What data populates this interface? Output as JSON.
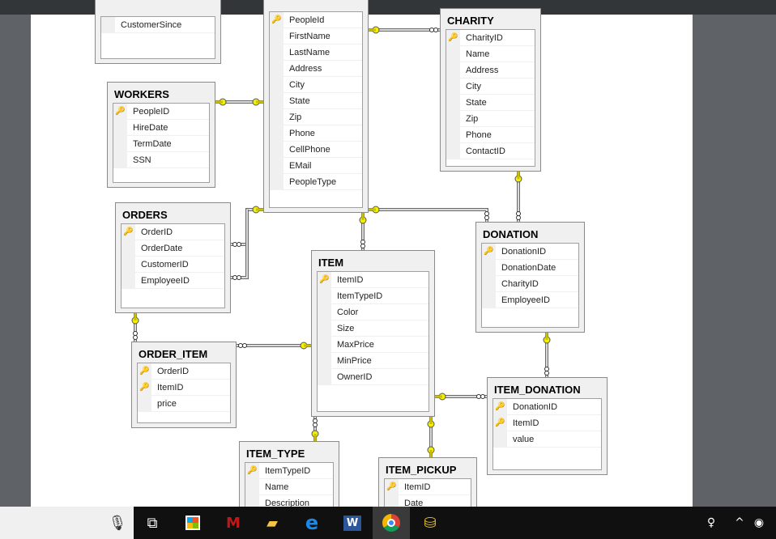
{
  "tables": [
    {
      "id": "customer",
      "title": "",
      "rows": [
        {
          "name": "CustomerSince",
          "pk": false
        }
      ]
    },
    {
      "id": "people",
      "title": "",
      "rows": [
        {
          "name": "PeopleId",
          "pk": true
        },
        {
          "name": "FirstName",
          "pk": false
        },
        {
          "name": "LastName",
          "pk": false
        },
        {
          "name": "Address",
          "pk": false
        },
        {
          "name": "City",
          "pk": false
        },
        {
          "name": "State",
          "pk": false
        },
        {
          "name": "Zip",
          "pk": false
        },
        {
          "name": "Phone",
          "pk": false
        },
        {
          "name": "CellPhone",
          "pk": false
        },
        {
          "name": "EMail",
          "pk": false
        },
        {
          "name": "PeopleType",
          "pk": false
        }
      ]
    },
    {
      "id": "charity",
      "title": "CHARITY",
      "rows": [
        {
          "name": "CharityID",
          "pk": true
        },
        {
          "name": "Name",
          "pk": false
        },
        {
          "name": "Address",
          "pk": false
        },
        {
          "name": "City",
          "pk": false
        },
        {
          "name": "State",
          "pk": false
        },
        {
          "name": "Zip",
          "pk": false
        },
        {
          "name": "Phone",
          "pk": false
        },
        {
          "name": "ContactID",
          "pk": false
        }
      ]
    },
    {
      "id": "workers",
      "title": "WORKERS",
      "rows": [
        {
          "name": "PeopleID",
          "pk": true
        },
        {
          "name": "HireDate",
          "pk": false
        },
        {
          "name": "TermDate",
          "pk": false
        },
        {
          "name": "SSN",
          "pk": false
        }
      ]
    },
    {
      "id": "orders",
      "title": "ORDERS",
      "rows": [
        {
          "name": "OrderID",
          "pk": true
        },
        {
          "name": "OrderDate",
          "pk": false
        },
        {
          "name": "CustomerID",
          "pk": false
        },
        {
          "name": "EmployeeID",
          "pk": false
        }
      ]
    },
    {
      "id": "item",
      "title": "ITEM",
      "rows": [
        {
          "name": "ItemID",
          "pk": true
        },
        {
          "name": "ItemTypeID",
          "pk": false
        },
        {
          "name": "Color",
          "pk": false
        },
        {
          "name": "Size",
          "pk": false
        },
        {
          "name": "MaxPrice",
          "pk": false
        },
        {
          "name": "MinPrice",
          "pk": false
        },
        {
          "name": "OwnerID",
          "pk": false
        }
      ]
    },
    {
      "id": "donation",
      "title": "DONATION",
      "rows": [
        {
          "name": "DonationID",
          "pk": true
        },
        {
          "name": "DonationDate",
          "pk": false
        },
        {
          "name": "CharityID",
          "pk": false
        },
        {
          "name": "EmployeeID",
          "pk": false
        }
      ]
    },
    {
      "id": "order_item",
      "title": "ORDER_ITEM",
      "rows": [
        {
          "name": "OrderID",
          "pk": true
        },
        {
          "name": "ItemID",
          "pk": true
        },
        {
          "name": "price",
          "pk": false
        }
      ]
    },
    {
      "id": "item_donation",
      "title": "ITEM_DONATION",
      "rows": [
        {
          "name": "DonationID",
          "pk": true
        },
        {
          "name": "ItemID",
          "pk": true
        },
        {
          "name": "value",
          "pk": false
        }
      ]
    },
    {
      "id": "item_type",
      "title": "ITEM_TYPE",
      "rows": [
        {
          "name": "ItemTypeID",
          "pk": true
        },
        {
          "name": "Name",
          "pk": false
        },
        {
          "name": "Description",
          "pk": false
        }
      ]
    },
    {
      "id": "item_pickup",
      "title": "ITEM_PICKUP",
      "rows": [
        {
          "name": "ItemID",
          "pk": true
        },
        {
          "name": "Date",
          "pk": false
        }
      ]
    }
  ],
  "taskbar": {
    "items": [
      "microphone-icon",
      "task-view-icon",
      "store-icon",
      "mcafee-icon",
      "file-explorer-icon",
      "edge-icon",
      "word-icon",
      "chrome-icon",
      "sql-tool-icon"
    ],
    "active": "chrome-icon"
  }
}
